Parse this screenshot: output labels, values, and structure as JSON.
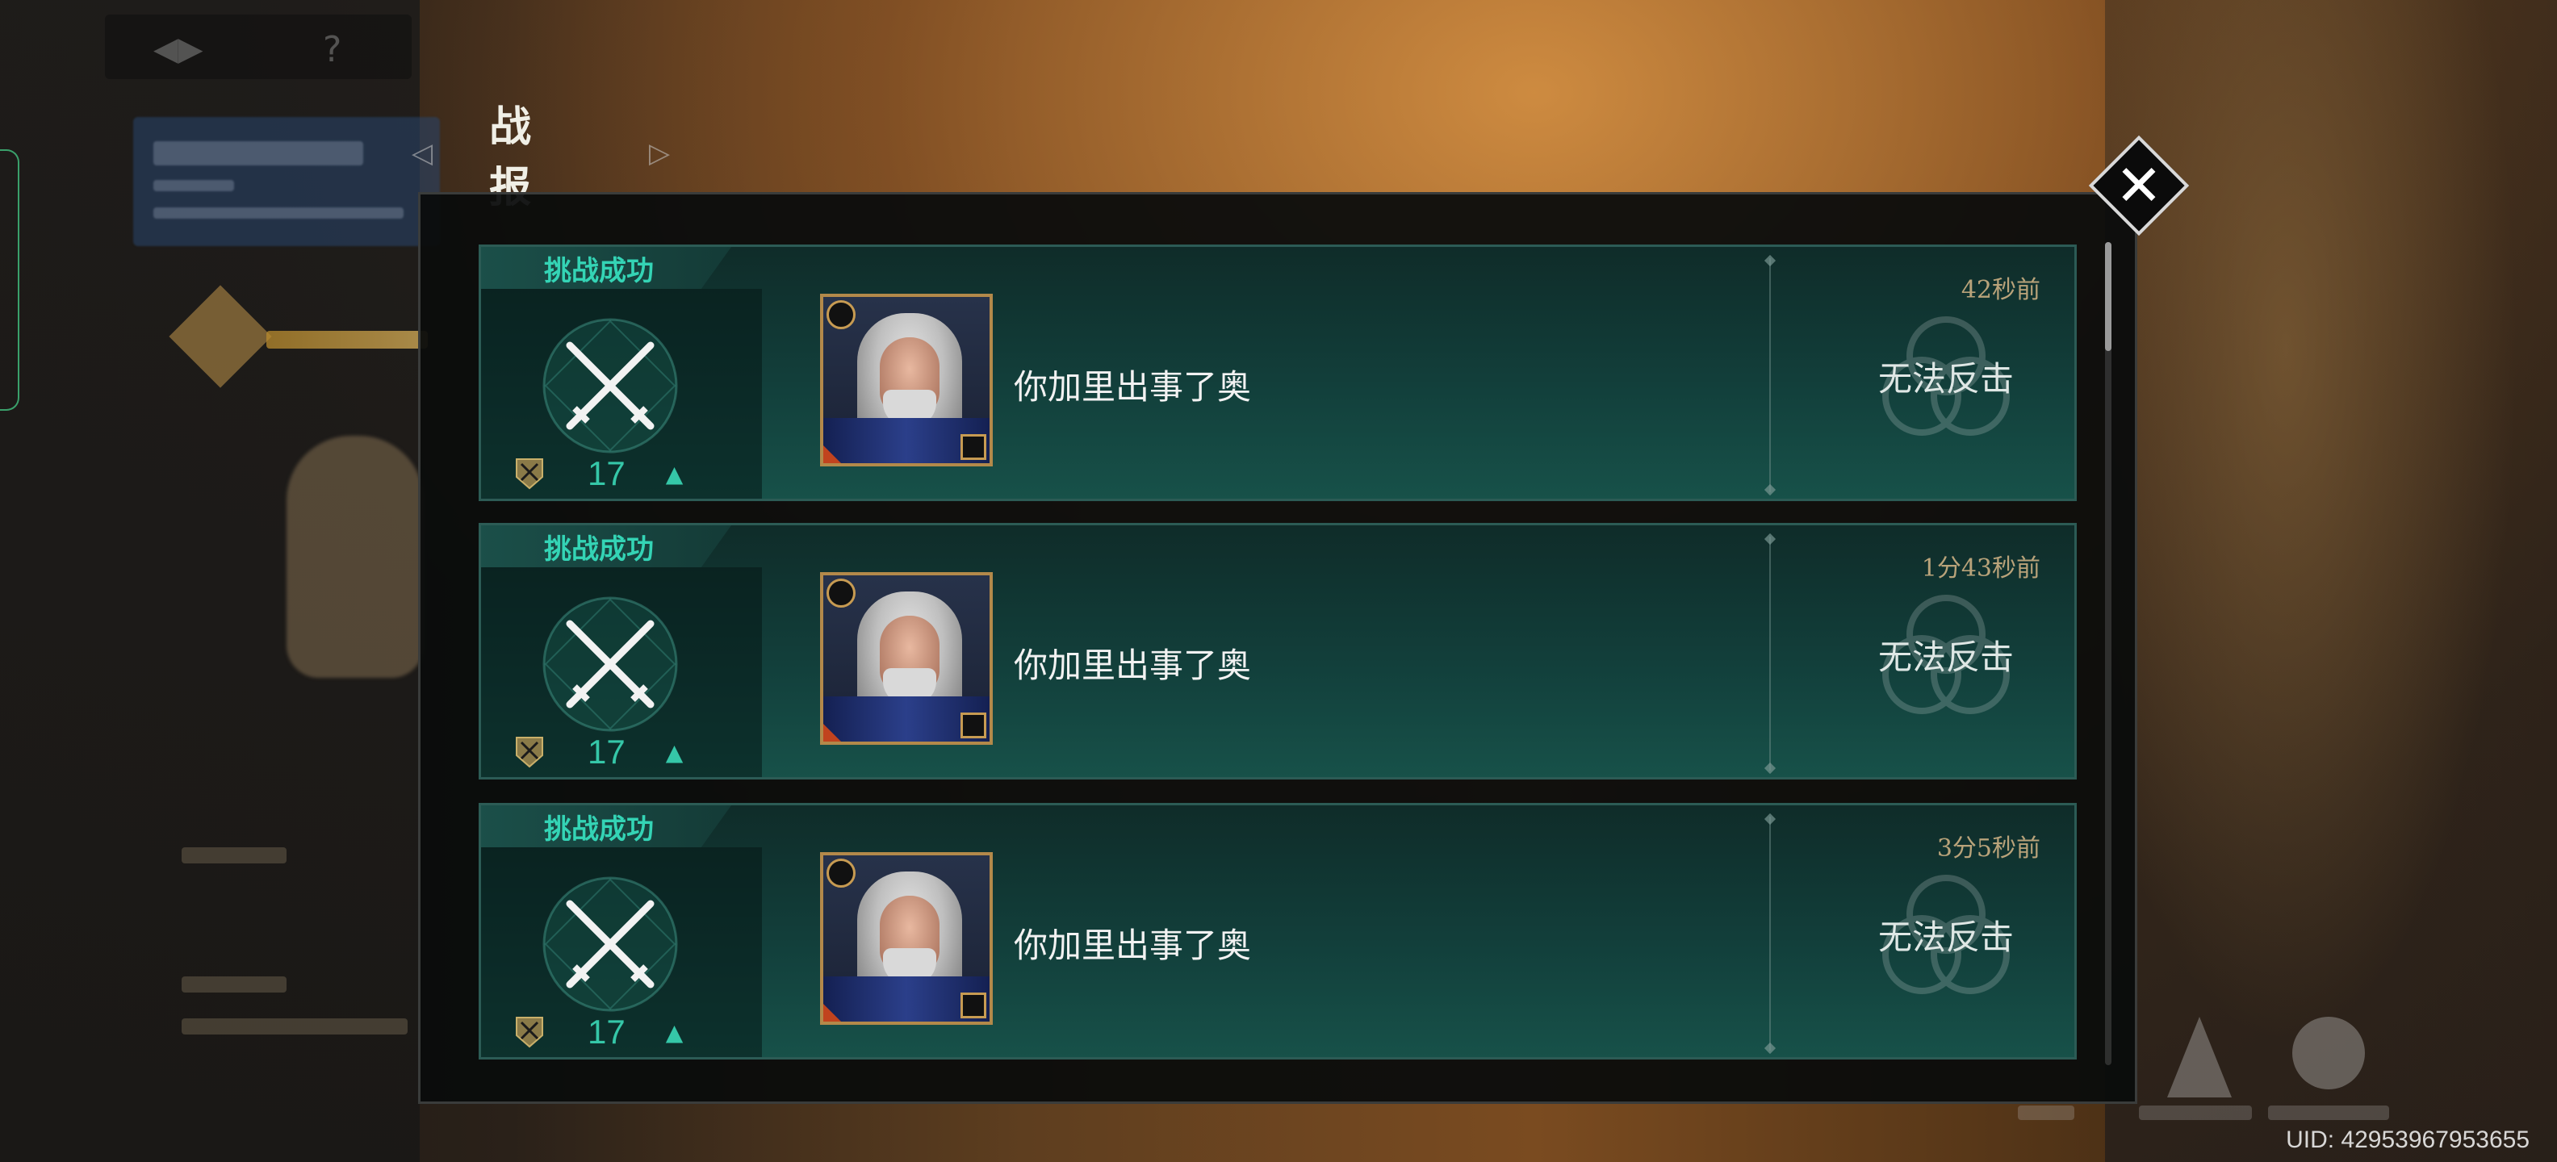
{
  "header": {
    "title": "战 报"
  },
  "reports": [
    {
      "status": "挑战成功",
      "level": "17",
      "player_name": "你加里出事了奥",
      "time": "42秒前",
      "action_label": "无法反击"
    },
    {
      "status": "挑战成功",
      "level": "17",
      "player_name": "你加里出事了奥",
      "time": "1分43秒前",
      "action_label": "无法反击"
    },
    {
      "status": "挑战成功",
      "level": "17",
      "player_name": "你加里出事了奥",
      "time": "3分5秒前",
      "action_label": "无法反击"
    }
  ],
  "footer": {
    "uid": "UID: 42953967953655"
  },
  "colors": {
    "accent_teal": "#34d4b5",
    "card_bg": "#123f3b",
    "time_gold": "#b9a37a",
    "portrait_frame": "#b3894a"
  },
  "icons": {
    "close": "close-icon",
    "swords": "crossed-swords-icon",
    "rank": "rank-crest-icon",
    "up": "arrow-up-icon",
    "nav_left": "arrow-left-icon",
    "nav_right": "arrow-right-icon"
  }
}
